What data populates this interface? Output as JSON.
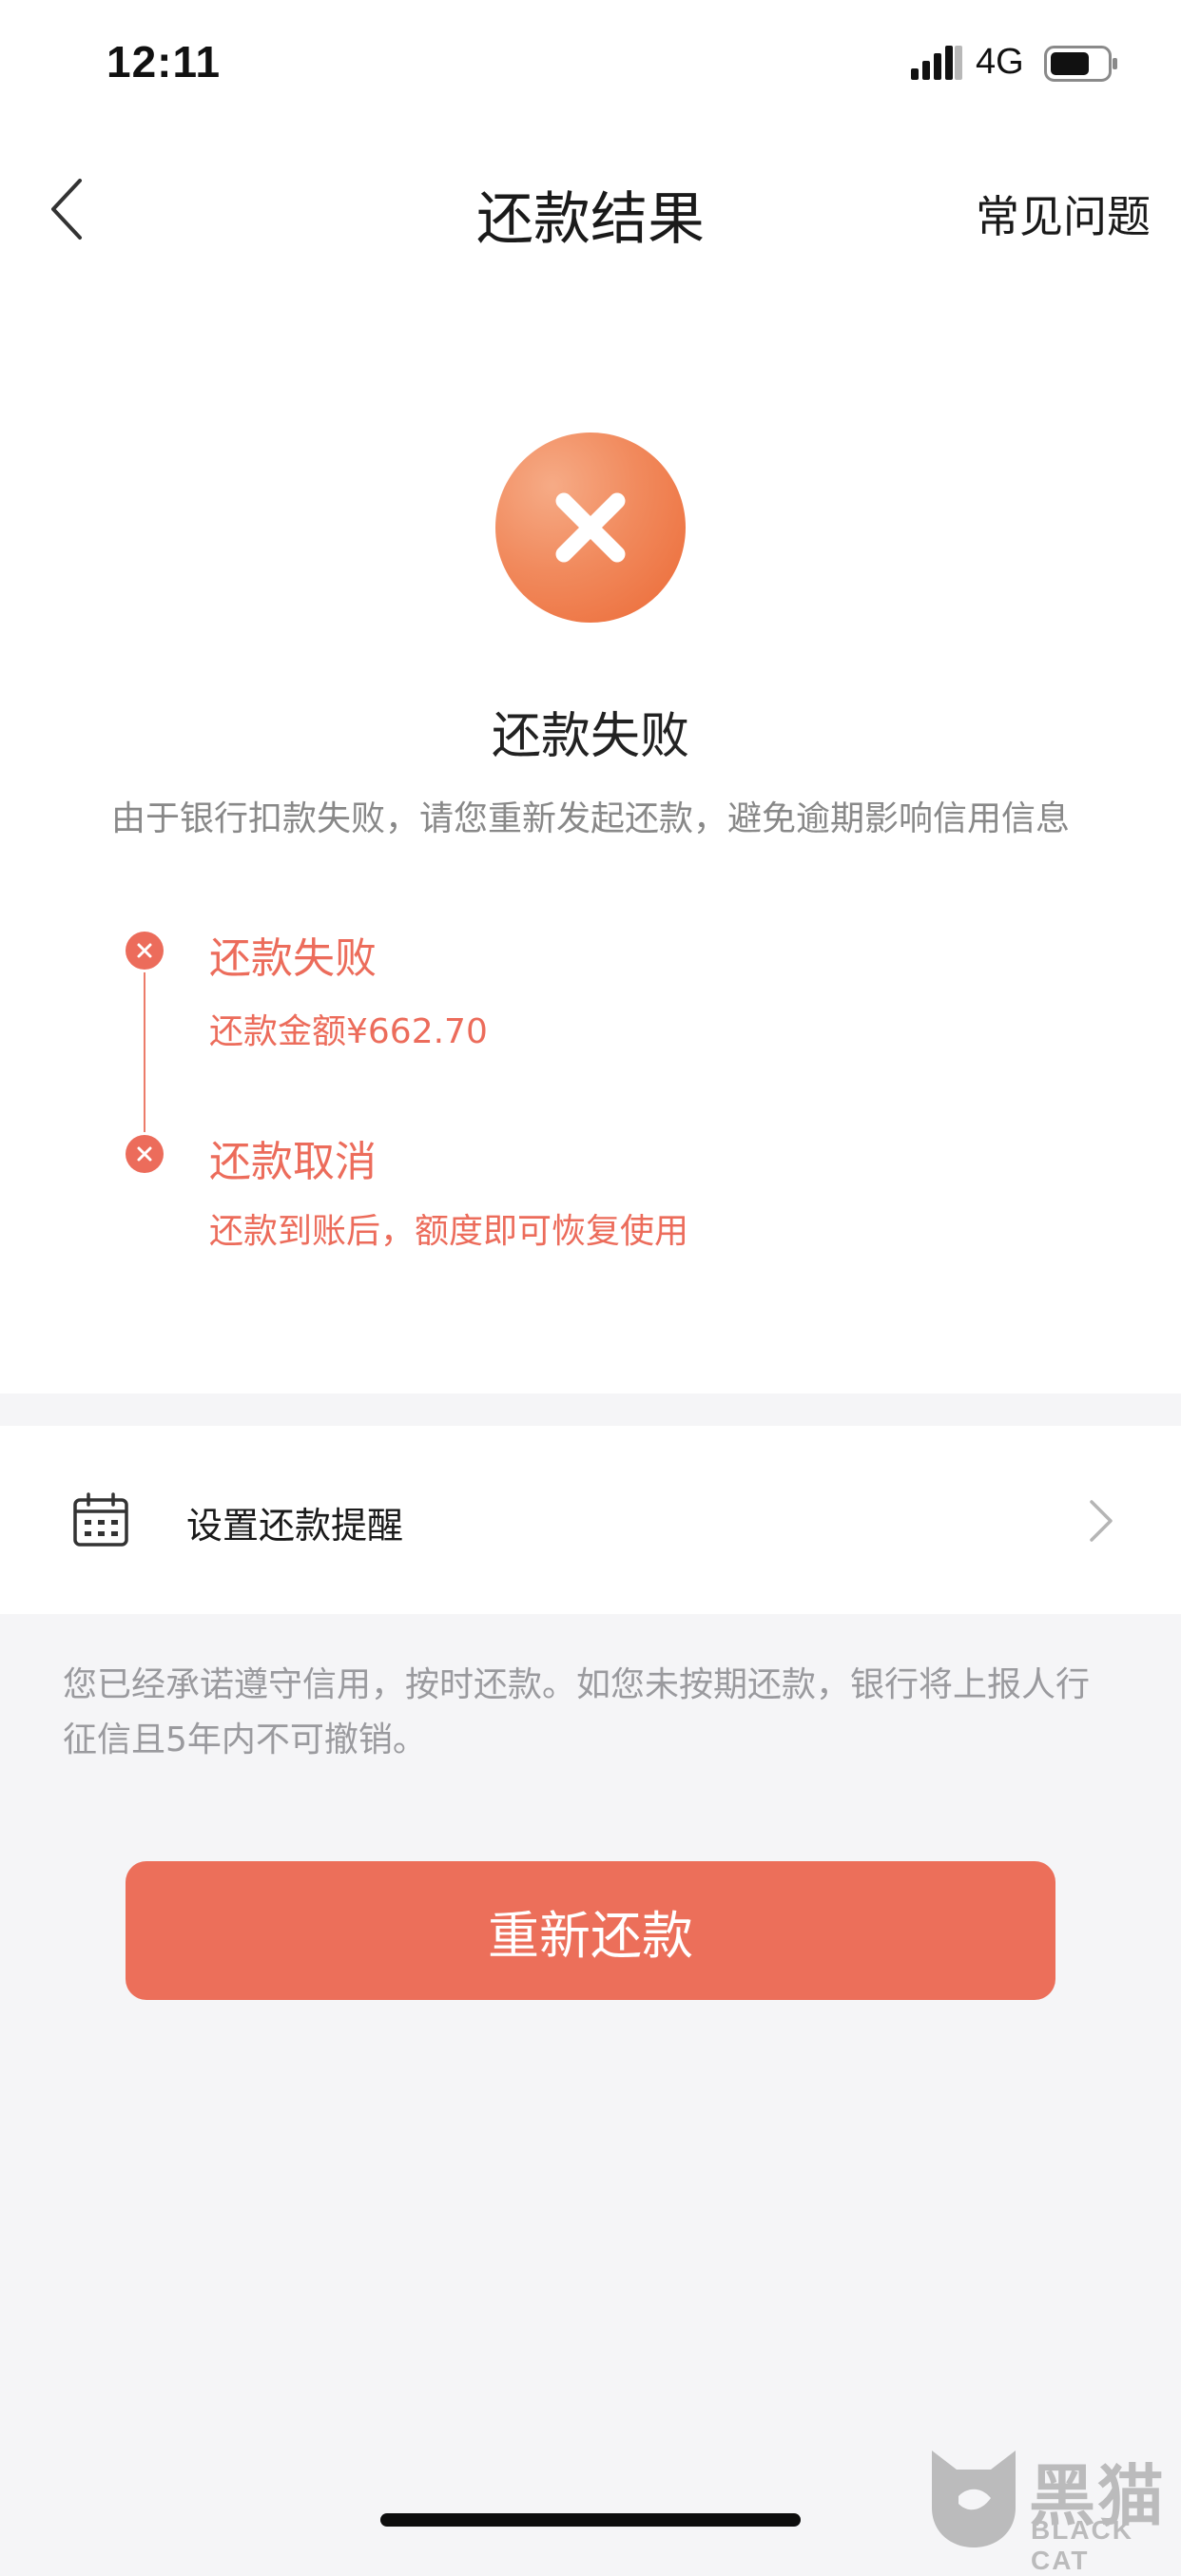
{
  "status_bar": {
    "time": "12:11",
    "network": "4G",
    "icons": [
      "signal-icon",
      "battery-icon"
    ]
  },
  "nav": {
    "title": "还款结果",
    "faq": "常见问题",
    "icons": [
      "back-chevron-icon"
    ]
  },
  "result": {
    "title": "还款失败",
    "description": "由于银行扣款失败，请您重新发起还款，避免逾期影响信用信息",
    "icon": "fail-x-icon",
    "accent_color": "#ec6c5b"
  },
  "timeline": [
    {
      "title": "还款失败",
      "detail": "还款金额¥662.70",
      "icon": "x-circle-icon"
    },
    {
      "title": "还款取消",
      "detail": "还款到账后，额度即可恢复使用",
      "icon": "x-circle-icon"
    }
  ],
  "reminder": {
    "label": "设置还款提醒",
    "icons": [
      "calendar-icon",
      "chevron-right-icon"
    ]
  },
  "notice": "您已经承诺遵守信用，按时还款。如您未按期还款，银行将上报人行征信且5年内不可撤销。",
  "retry_button": {
    "label": "重新还款",
    "color": "#ec6f5a"
  },
  "watermark": {
    "cn": "黑猫",
    "en": "BLACK CAT",
    "icon": "black-cat-logo-icon"
  }
}
